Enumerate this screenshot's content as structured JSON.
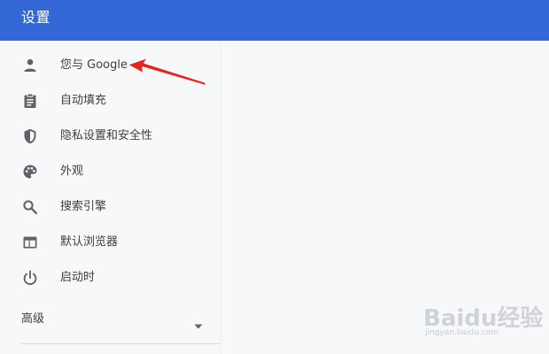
{
  "header": {
    "title": "设置"
  },
  "menu": {
    "items": [
      {
        "icon": "person-icon",
        "label": "您与 Google"
      },
      {
        "icon": "clipboard-icon",
        "label": "自动填充"
      },
      {
        "icon": "shield-icon",
        "label": "隐私设置和安全性"
      },
      {
        "icon": "palette-icon",
        "label": "外观"
      },
      {
        "icon": "search-icon",
        "label": "搜索引擎"
      },
      {
        "icon": "browser-window-icon",
        "label": "默认浏览器"
      },
      {
        "icon": "power-icon",
        "label": "启动时"
      }
    ],
    "advanced": {
      "label": "高级",
      "icon": "caret-down-icon"
    }
  },
  "watermark": {
    "text": "Baidu经验",
    "sub": "jingyan.baidu.com"
  },
  "colors": {
    "header_bg": "#3367d6",
    "page_bg": "#f7f8fa",
    "icon": "#5f6368",
    "text": "#3c4043",
    "arrow": "#e8231c"
  }
}
